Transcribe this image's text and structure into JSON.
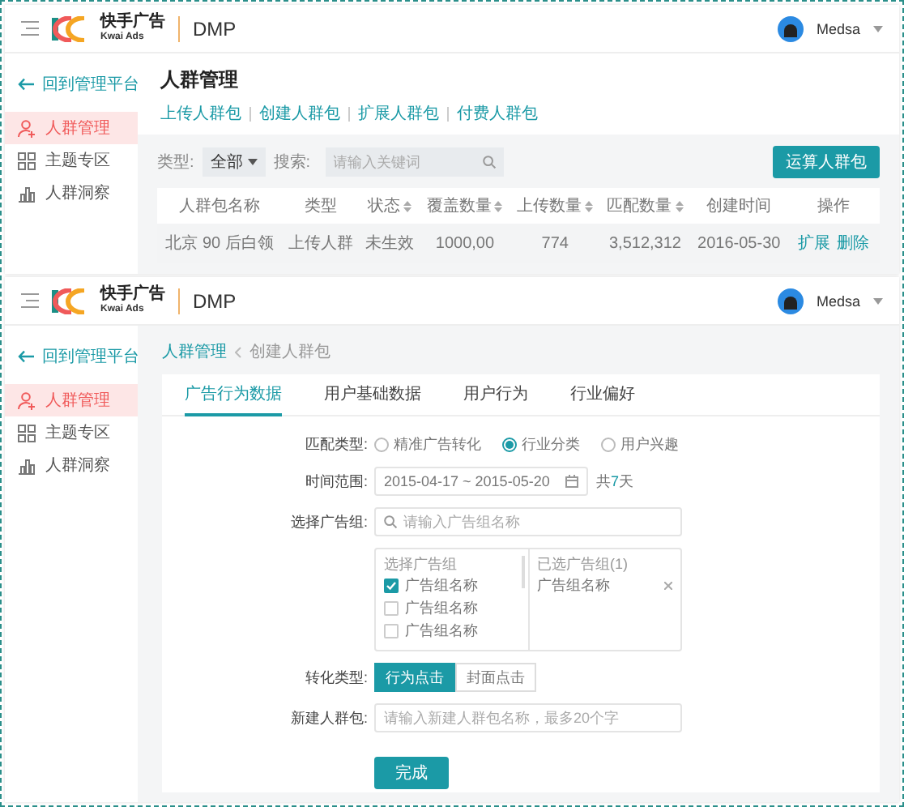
{
  "list_page": {
    "header": {
      "logo_cn": "快手广告",
      "logo_en": "Kwai Ads",
      "product": "DMP",
      "user": "Medsa"
    },
    "sidebar": {
      "back": "回到管理平台",
      "items": [
        {
          "label": "人群管理",
          "selected": true
        },
        {
          "label": "主题专区",
          "selected": false
        },
        {
          "label": "人群洞察",
          "selected": false
        }
      ]
    },
    "title": "人群管理",
    "links": [
      "上传人群包",
      "创建人群包",
      "扩展人群包",
      "付费人群包"
    ],
    "filter": {
      "type_label": "类型:",
      "type_value": "全部",
      "search_label": "搜索:",
      "search_placeholder": "请输入关键词"
    },
    "action_button": "运算人群包",
    "table": {
      "columns": [
        {
          "label": "人群包名称",
          "sortable": false
        },
        {
          "label": "类型",
          "sortable": false
        },
        {
          "label": "状态",
          "sortable": true
        },
        {
          "label": "覆盖数量",
          "sortable": true
        },
        {
          "label": "上传数量",
          "sortable": true
        },
        {
          "label": "匹配数量",
          "sortable": true
        },
        {
          "label": "创建时间",
          "sortable": false
        },
        {
          "label": "操作",
          "sortable": false
        }
      ],
      "rows": [
        {
          "cells": [
            "北京 90 后白领",
            "上传人群",
            "未生效",
            "1000,00",
            "774",
            "3,512,312",
            "2016-05-30"
          ],
          "actions": [
            "扩展",
            "删除"
          ]
        }
      ]
    }
  },
  "create_page": {
    "header": {
      "logo_cn": "快手广告",
      "logo_en": "Kwai Ads",
      "product": "DMP",
      "user": "Medsa"
    },
    "sidebar": {
      "back": "回到管理平台",
      "items": [
        {
          "label": "人群管理",
          "selected": true
        },
        {
          "label": "主题专区",
          "selected": false
        },
        {
          "label": "人群洞察",
          "selected": false
        }
      ]
    },
    "breadcrumb": [
      "人群管理",
      "创建人群包"
    ],
    "tabs": [
      {
        "label": "广告行为数据",
        "selected": true
      },
      {
        "label": "用户基础数据",
        "selected": false
      },
      {
        "label": "用户行为",
        "selected": false
      },
      {
        "label": "行业偏好",
        "selected": false
      }
    ],
    "match_type": {
      "label": "匹配类型:",
      "options": [
        {
          "label": "精准广告转化",
          "selected": false
        },
        {
          "label": "行业分类",
          "selected": true
        },
        {
          "label": "用户兴趣",
          "selected": false
        }
      ]
    },
    "time_range": {
      "label": "时间范围:",
      "value": "2015-04-17 ~ 2015-05-20",
      "note": "共**7**天"
    },
    "ad_group": {
      "label": "选择广告组:",
      "search_placeholder": "请输入广告组名称",
      "left_header": "选择广告组",
      "items": [
        {
          "label": "广告组名称",
          "checked": true
        },
        {
          "label": "广告组名称",
          "checked": false
        },
        {
          "label": "广告组名称",
          "checked": false
        }
      ],
      "right_header": "已选广告组(1)",
      "selected_items": [
        "广告组名称"
      ]
    },
    "conversion": {
      "label": "转化类型:",
      "options": [
        {
          "label": "行为点击",
          "selected": true
        },
        {
          "label": "封面点击",
          "selected": false
        }
      ]
    },
    "new_name": {
      "label": "新建人群包:",
      "placeholder": "请输入新建人群包名称，最多20个字"
    },
    "submit": "完成"
  }
}
